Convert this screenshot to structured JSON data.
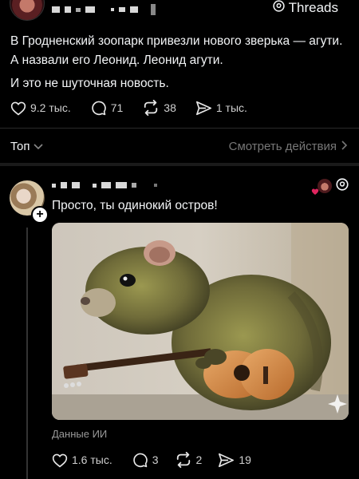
{
  "header": {
    "brand": "Threads"
  },
  "post1": {
    "paragraph1": "В Гродненский зоопарк привезли нового зверька — агути. А назвали его Леонид. Леонид агути.",
    "paragraph2": "И это не шуточная новость.",
    "likes": "9.2 тыс.",
    "comments": "71",
    "reposts": "38",
    "shares": "1 тыс."
  },
  "sort": {
    "label": "Топ",
    "see_actions": "Смотреть действия"
  },
  "post2": {
    "text": "Просто, ты одинокий остров!",
    "image_label": "Данные ИИ",
    "likes": "1.6 тыс.",
    "comments": "3",
    "reposts": "2",
    "shares": "19"
  },
  "colors": {
    "background": "#000000",
    "text": "#f3f5f7",
    "muted": "#777777",
    "heart_red": "#e0245e"
  }
}
